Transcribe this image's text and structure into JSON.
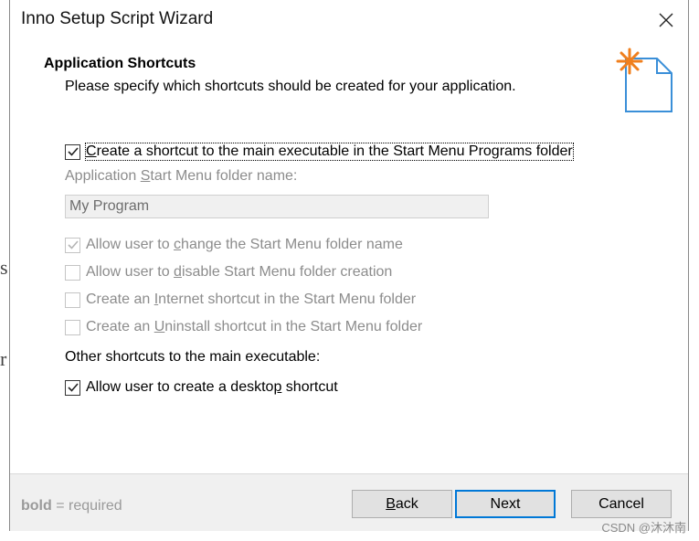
{
  "background": {
    "fragment_1": "s",
    "fragment_2": "r"
  },
  "window": {
    "title": "Inno Setup Script Wizard"
  },
  "header": {
    "title": "Application Shortcuts",
    "subtitle": "Please specify which shortcuts should be created for your application."
  },
  "options": {
    "main_shortcut": {
      "checked": true,
      "enabled": true,
      "pre": "",
      "key": "C",
      "post": "reate a shortcut to the main executable in the Start Menu Programs folder"
    },
    "folder_label": {
      "pre": "Application ",
      "key": "S",
      "post": "tart Menu folder name:"
    },
    "folder_value": "My Program",
    "allow_change": {
      "checked": true,
      "enabled": false,
      "pre": "Allow user to ",
      "key": "c",
      "post": "hange the Start Menu folder name"
    },
    "allow_disable": {
      "checked": false,
      "enabled": false,
      "pre": "Allow user to ",
      "key": "d",
      "post": "isable Start Menu folder creation"
    },
    "internet_shortcut": {
      "checked": false,
      "enabled": false,
      "pre": "Create an ",
      "key": "I",
      "post": "nternet shortcut in the Start Menu folder"
    },
    "uninstall_shortcut": {
      "checked": false,
      "enabled": false,
      "pre": "Create an ",
      "key": "U",
      "post": "ninstall shortcut in the Start Menu folder"
    },
    "other_label": "Other shortcuts to the main executable:",
    "desktop_shortcut": {
      "checked": true,
      "enabled": true,
      "pre": "Allow user to create a deskto",
      "key": "p",
      "post": " shortcut"
    }
  },
  "footer": {
    "legend_bold": "bold",
    "legend_rest": " = required",
    "back_pre": "",
    "back_key": "B",
    "back_post": "ack",
    "next_label": "Next",
    "cancel_label": "Cancel"
  },
  "watermark": "CSDN @沐沐南",
  "colors": {
    "accent": "#0078d7",
    "icon_star": "#f07f1d",
    "disabled_text": "#8c8c8c"
  }
}
